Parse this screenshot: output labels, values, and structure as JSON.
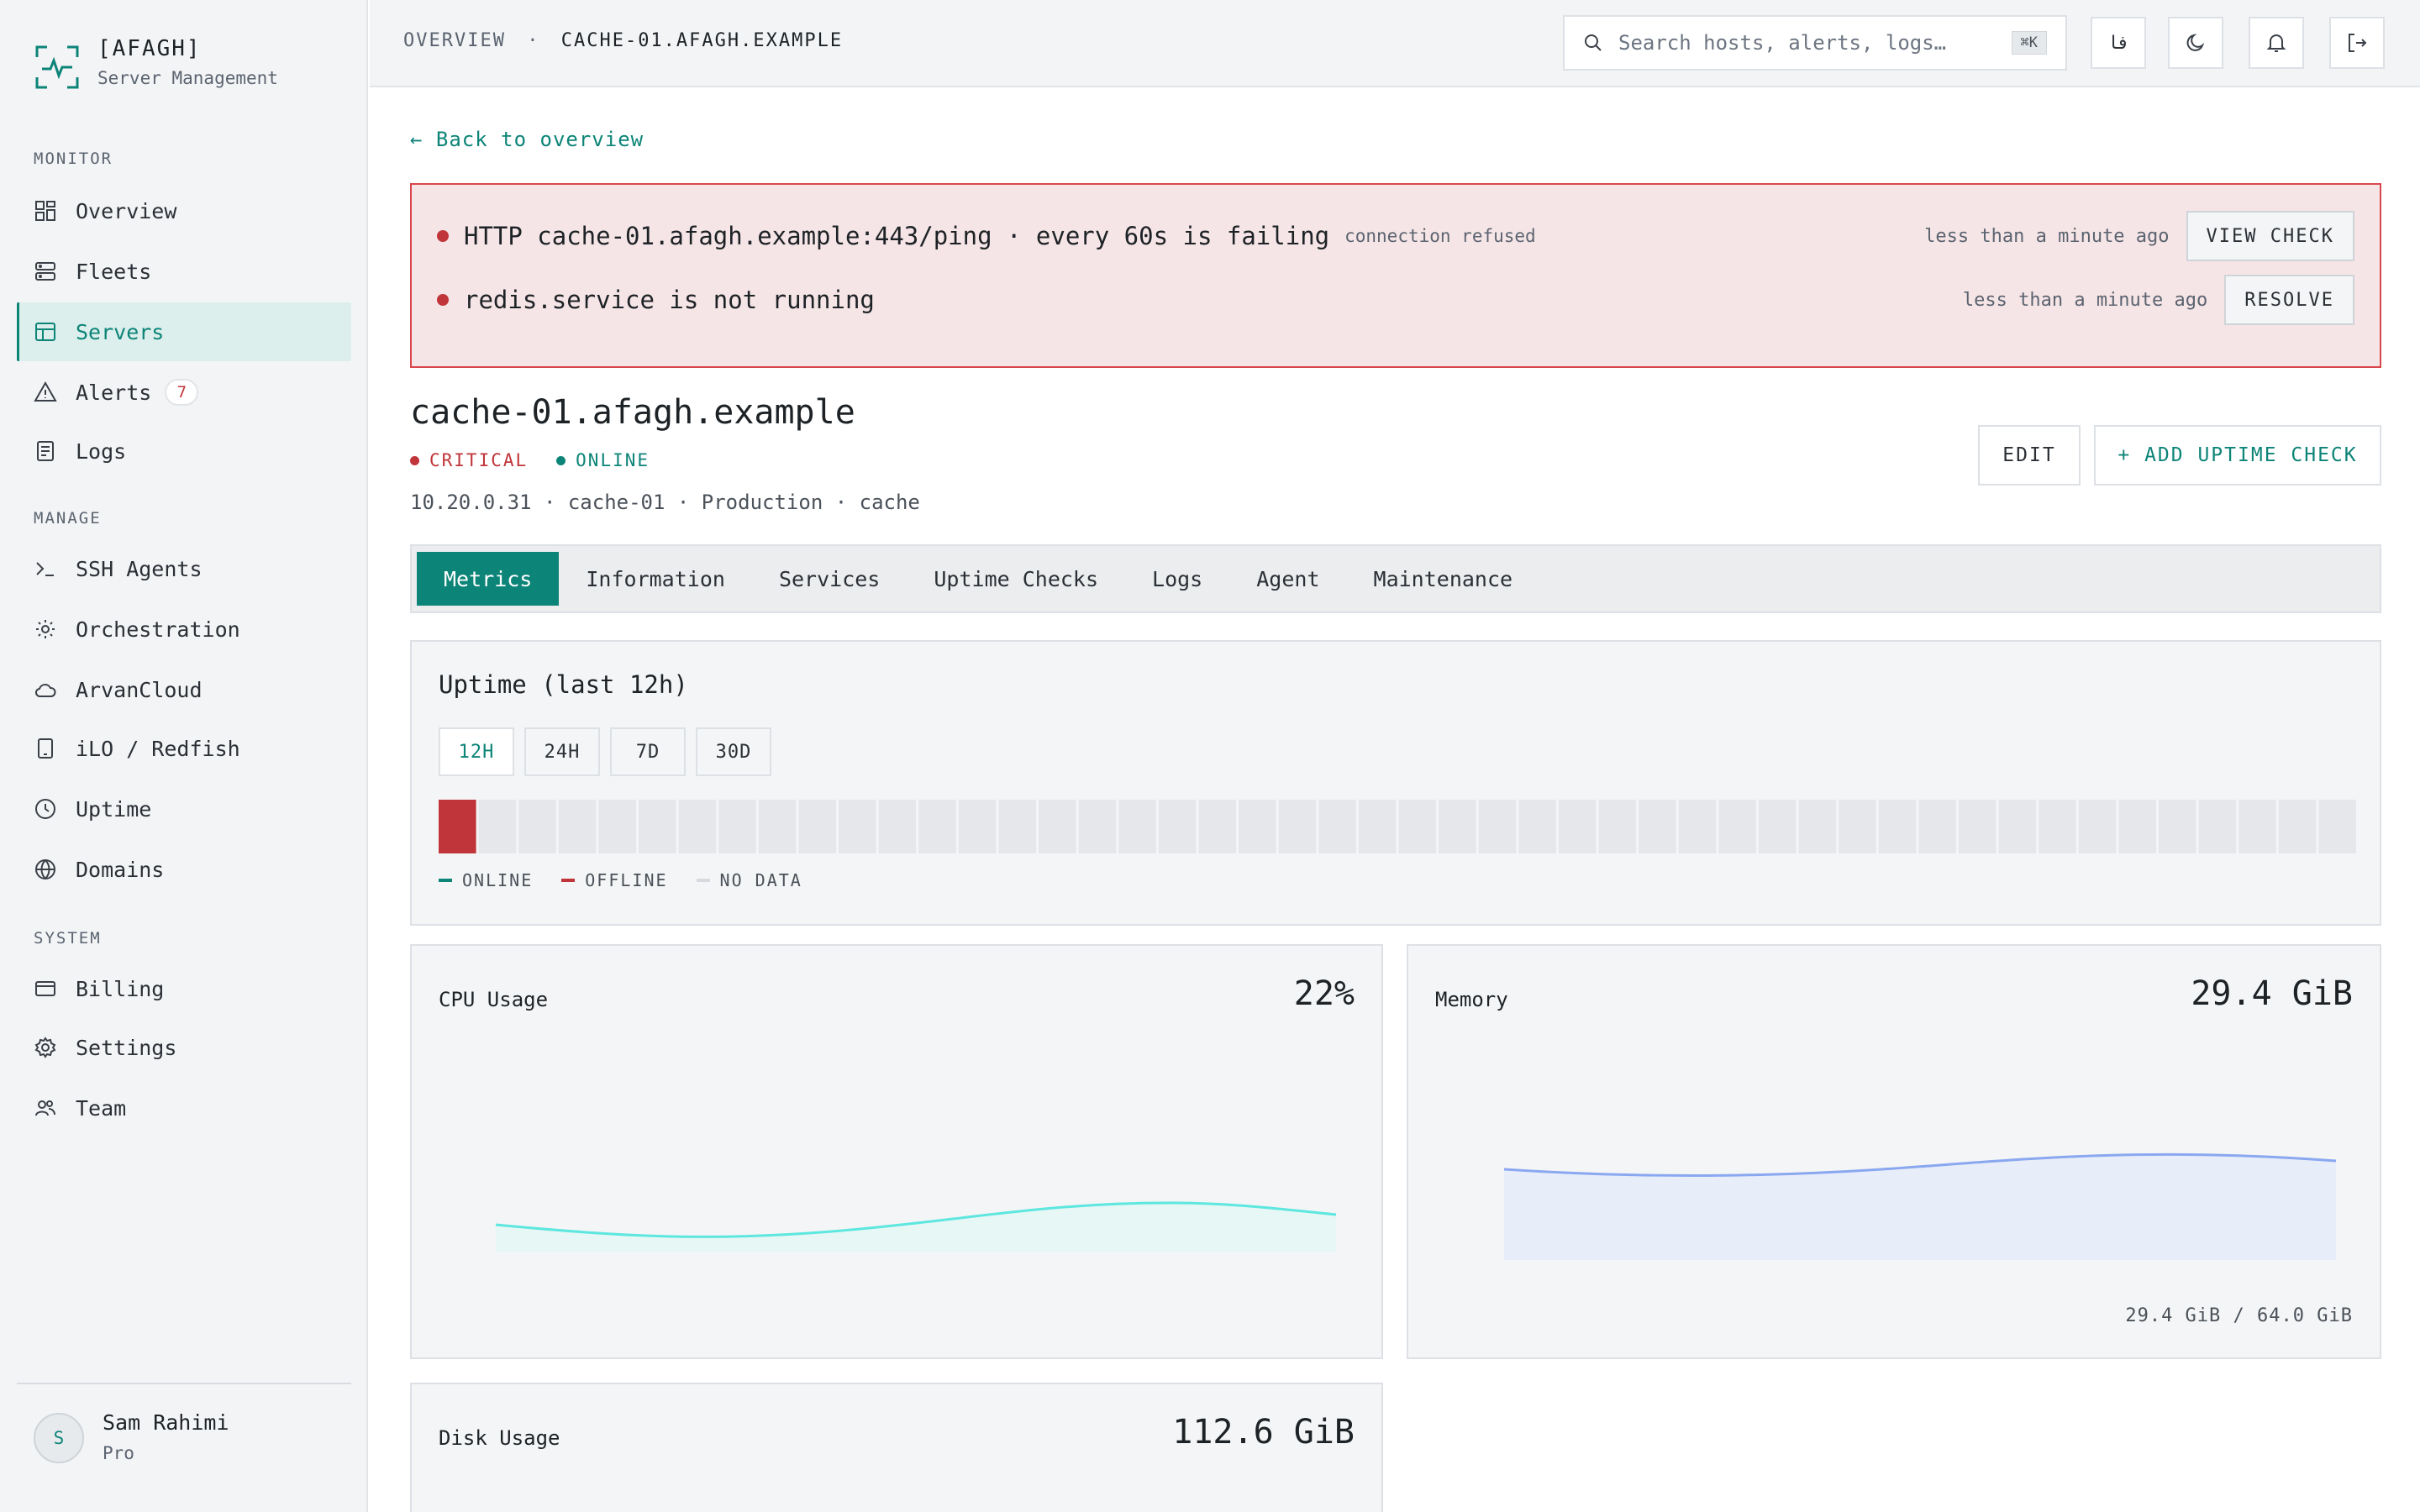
{
  "brand": {
    "name": "[AFAGH]",
    "subtitle": "Server Management"
  },
  "sidebar": {
    "monitor_label": "MONITOR",
    "manage_label": "MANAGE",
    "system_label": "SYSTEM",
    "monitor": [
      {
        "label": "Overview",
        "icon": "grid-icon"
      },
      {
        "label": "Fleets",
        "icon": "server-stack-icon"
      },
      {
        "label": "Servers",
        "icon": "table-icon",
        "active": true
      },
      {
        "label": "Alerts",
        "icon": "warning-icon",
        "badge": "7"
      },
      {
        "label": "Logs",
        "icon": "document-icon"
      }
    ],
    "manage": [
      {
        "label": "SSH Agents",
        "icon": "terminal-icon"
      },
      {
        "label": "Orchestration",
        "icon": "sun-gear-icon"
      },
      {
        "label": "ArvanCloud",
        "icon": "cloud-icon"
      },
      {
        "label": "iLO / Redfish",
        "icon": "tablet-icon"
      },
      {
        "label": "Uptime",
        "icon": "clock-icon"
      },
      {
        "label": "Domains",
        "icon": "globe-icon"
      }
    ],
    "system": [
      {
        "label": "Billing",
        "icon": "credit-card-icon"
      },
      {
        "label": "Settings",
        "icon": "gear-icon"
      },
      {
        "label": "Team",
        "icon": "users-icon"
      }
    ],
    "user": {
      "initial": "S",
      "name": "Sam Rahimi",
      "plan": "Pro"
    }
  },
  "topbar": {
    "crumb_root": "OVERVIEW",
    "crumb_sep": "·",
    "crumb_current": "CACHE-01.AFAGH.EXAMPLE",
    "search_placeholder": "Search hosts, alerts, logs…",
    "search_shortcut": "⌘K",
    "lang_label": "فا"
  },
  "main": {
    "back_label": "← Back to overview",
    "alerts": [
      {
        "text": "HTTP cache-01.afagh.example:443/ping · every 60s is failing",
        "detail": "connection refused",
        "time": "less than a minute ago",
        "action": "VIEW CHECK"
      },
      {
        "text": "redis.service is not running",
        "detail": "",
        "time": "less than a minute ago",
        "action": "RESOLVE"
      }
    ],
    "host": {
      "name": "cache-01.afagh.example",
      "status_critical": "CRITICAL",
      "status_online": "ONLINE",
      "meta": "10.20.0.31 · cache-01 · Production · cache",
      "edit_label": "EDIT",
      "add_check_label": "+ ADD UPTIME CHECK"
    },
    "tabs": [
      "Metrics",
      "Information",
      "Services",
      "Uptime Checks",
      "Logs",
      "Agent",
      "Maintenance"
    ],
    "uptime": {
      "title": "Uptime (last 12h)",
      "ranges": [
        "12H",
        "24H",
        "7D",
        "30D"
      ],
      "selected_range": "12H",
      "bars_total": 48,
      "offline_bars": [
        0
      ],
      "legend_online": "ONLINE",
      "legend_offline": "OFFLINE",
      "legend_nodata": "NO DATA"
    },
    "cpu": {
      "title": "CPU Usage",
      "value": "22%"
    },
    "memory": {
      "title": "Memory",
      "value": "29.4 GiB",
      "footer": "29.4 GiB / 64.0 GiB"
    },
    "disk": {
      "title": "Disk Usage",
      "value": "112.6 GiB"
    }
  },
  "colors": {
    "accent": "#0d8478",
    "critical": "#c0353a",
    "alert_bg": "#f6e5e6",
    "cpu_line": "#5ee7df",
    "memory_line": "#8aa8f0"
  }
}
